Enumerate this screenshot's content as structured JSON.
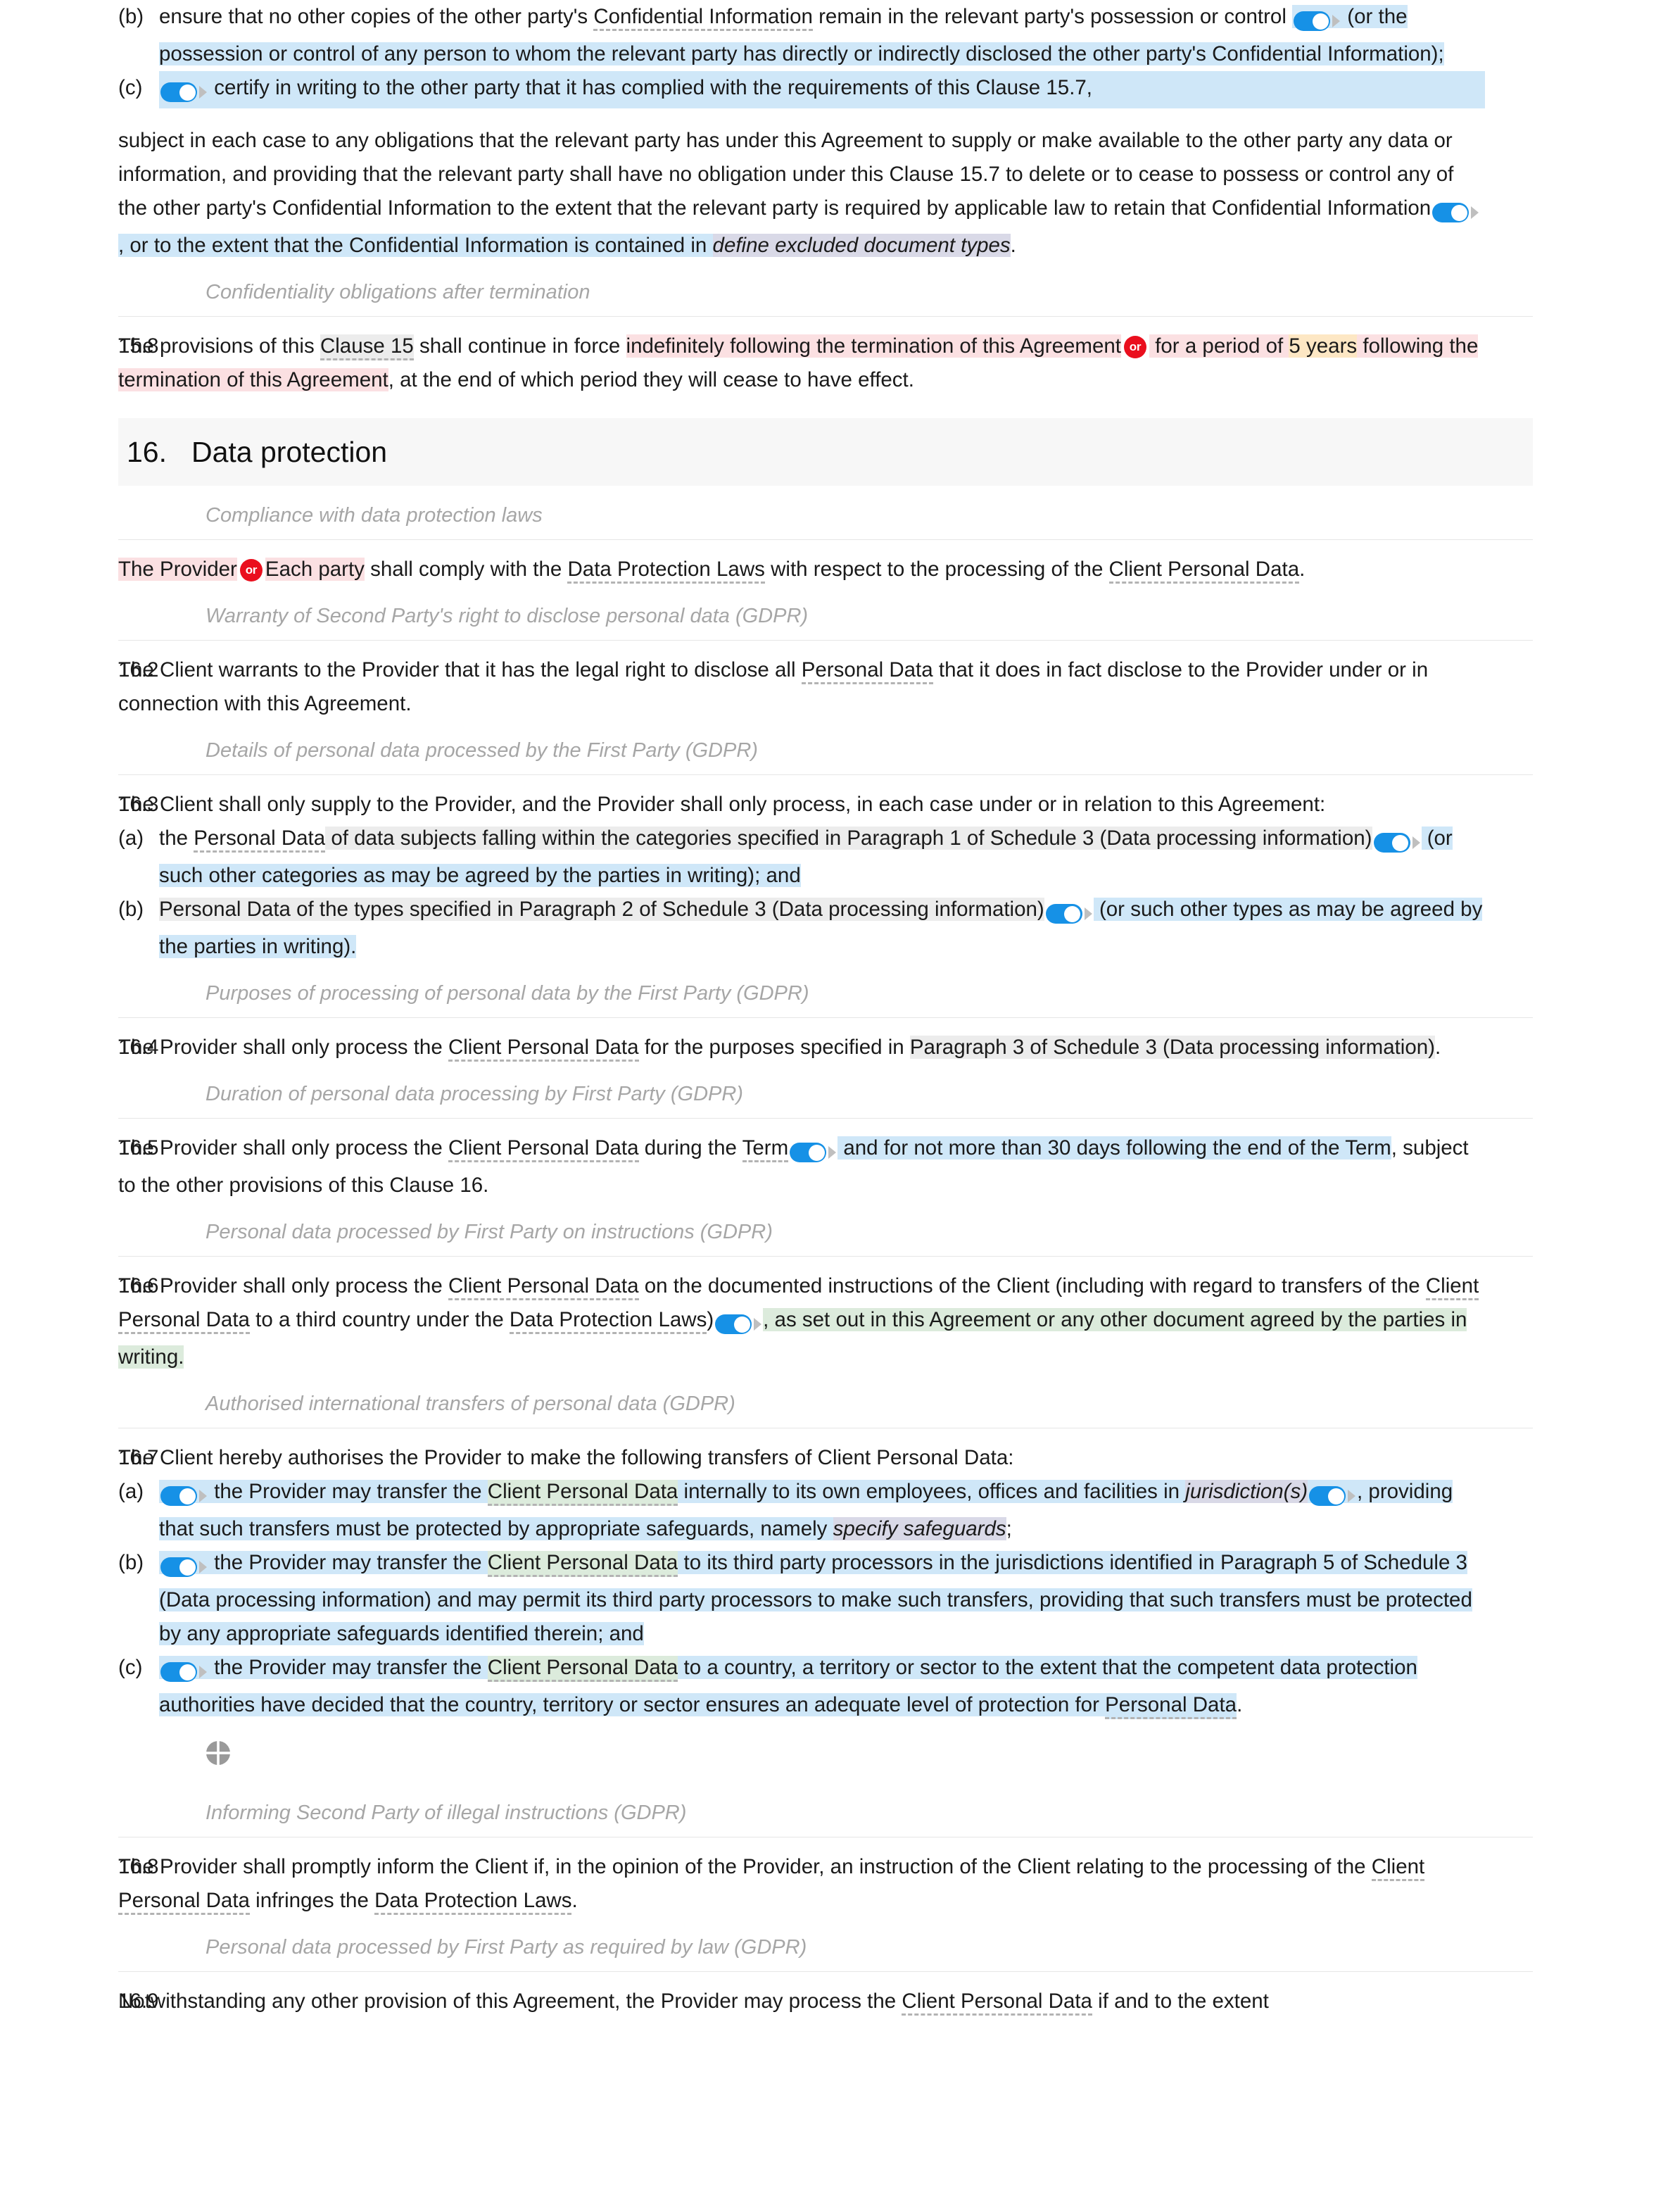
{
  "document": {
    "type": "legal-contract",
    "visible_sections": [
      "15 (continued)",
      "16. Data protection"
    ]
  },
  "colors": {
    "toggle_blue": "#1691e6",
    "or_badge_red": "#ea0f1e",
    "highlight_blue": "#cfe7f8",
    "highlight_green": "#dcebdc",
    "highlight_pink": "#fbe0e2",
    "highlight_orange": "#fde7c4",
    "highlight_grey": "#ececec",
    "highlight_lavender": "#d9d9e7",
    "subheading_grey": "#a6a6a6",
    "section_band": "#f7f7f7"
  },
  "icons": {
    "toggle": "toggle-switch-on-icon",
    "or_badge": "or-alternative-badge",
    "quadrant": "crosshair-quadrant-icon"
  },
  "clause_15_7": {
    "item_b_marker": "(b)",
    "item_b_text_1": "ensure that no other copies of the other party's ",
    "item_b_defined_1": "Confidential Information",
    "item_b_text_2": " remain in the relevant party's possession or control ",
    "item_b_text_3": " (or the possession or control of any person to whom the relevant party has directly or indirectly disclosed the other party's Confidential Information);",
    "item_c_marker": "(c)",
    "item_c_text": " certify in writing to the other party that it has complied with the requirements of this Clause 15.7,",
    "tail_1": "subject in each case to any obligations that the relevant party has under this Agreement to supply or make available to the other party any data or information, and providing that the relevant party shall have no obligation under this Clause 15.7 to delete or to cease to possess or control any of the other party's Confidential Information to the extent that the relevant party is required by applicable law to retain that Confidential Information",
    "tail_2": ", or to the extent that the Confidential Information is contained in ",
    "tail_placeholder": "define excluded document types",
    "tail_3": "."
  },
  "subheading_confidentiality": "Confidentiality obligations after termination",
  "clause_15_8": {
    "number": "15.8",
    "t1": "The provisions of this ",
    "defined_1": "Clause 15",
    "t2": " shall continue in force ",
    "alt_a": "indefinitely following the termination of this Agreement",
    "or": "or",
    "alt_b_pre": " for a period of ",
    "alt_b_num": "5 years",
    "alt_b_post": " following the termination of this Agreement",
    "t3": ", at the end of which period they will cease to have effect."
  },
  "section_16": {
    "number": "16.",
    "title": "Data protection"
  },
  "subheadings": {
    "compliance": "Compliance with data protection laws",
    "warranty": "Warranty of Second Party's right to disclose personal data (GDPR)",
    "details": "Details of personal data processed by the First Party (GDPR)",
    "purposes": "Purposes of processing of personal data by the First Party (GDPR)",
    "duration": "Duration of personal data processing by First Party (GDPR)",
    "instructions": "Personal data processed by First Party on instructions (GDPR)",
    "transfers": "Authorised international transfers of personal data (GDPR)",
    "informing": "Informing Second Party of illegal instructions (GDPR)",
    "required_by_law": "Personal data processed by First Party as required by law (GDPR)"
  },
  "clause_16_1": {
    "number": "16.1",
    "alt_a": "The Provider",
    "or": "or",
    "alt_b": "Each party",
    "t1": " shall comply with the ",
    "defined_1": "Data Protection Laws",
    "t2": " with respect to the processing of the ",
    "defined_2": "Client Personal Data",
    "t3": "."
  },
  "clause_16_2": {
    "number": "16.2",
    "t1": "The Client warrants to the Provider that it has the legal right to disclose all ",
    "defined_1": "Personal Data",
    "t2": " that it does in fact disclose to the Provider under or in connection with this Agreement."
  },
  "clause_16_3": {
    "number": "16.3",
    "lead": "The Client shall only supply to the Provider, and the Provider shall only process, in each case under or in relation to this Agreement:",
    "a_marker": "(a)",
    "a_t1": "the ",
    "a_defined": "Personal Data",
    "a_t2": " of data subjects falling within the categories specified in Paragraph 1 of Schedule 3 (Data processing information)",
    "a_t3": " (or such other categories as may be agreed by the parties in writing); and",
    "b_marker": "(b)",
    "b_t1": "Personal Data of the types specified in Paragraph 2 of Schedule 3 (Data processing information)",
    "b_t2": " (or such other types as may be agreed by the parties in writing)."
  },
  "clause_16_4": {
    "number": "16.4",
    "t1": "The Provider shall only process the ",
    "defined_1": "Client Personal Data",
    "t2": " for the purposes specified in ",
    "hl": "Paragraph 3 of Schedule 3 (Data processing information)",
    "t3": "."
  },
  "clause_16_5": {
    "number": "16.5",
    "t1": "The Provider shall only process the ",
    "defined_1": "Client Personal Data",
    "t2": " during the ",
    "defined_2": "Term",
    "t3": " and for not more than 30 days following the end of the Term",
    "t4": ", subject to the other provisions of this Clause 16."
  },
  "clause_16_6": {
    "number": "16.6",
    "t1": "The Provider shall only process the ",
    "defined_1": "Client Personal Data",
    "t2": " on the documented instructions of the Client (including with regard to transfers of the ",
    "defined_2": "Client Personal Data",
    "t3": " to a third country under the ",
    "defined_3": "Data Protection Laws",
    "t4": ")",
    "t5": ", as set out in this Agreement or any other document agreed by the parties in writing."
  },
  "clause_16_7": {
    "number": "16.7",
    "lead": "The Client hereby authorises the Provider to make the following transfers of Client Personal Data:",
    "a_marker": "(a)",
    "a_t1": " the Provider may transfer the ",
    "a_defined": "Client Personal Data",
    "a_t2": " internally to its own employees, offices and facilities in ",
    "a_placeholder": "jurisdiction(s)",
    "a_t3": ", providing that such transfers must be protected by appropriate safeguards, namely ",
    "a_placeholder2": "specify safeguards",
    "a_t4": ";",
    "b_marker": "(b)",
    "b_t1": " the Provider may transfer the ",
    "b_defined": "Client Personal Data",
    "b_t2": " to its third party processors in the jurisdictions identified in Paragraph 5 of Schedule 3 (Data processing information) and may permit its third party processors to make such transfers, providing that such transfers must be protected by any appropriate safeguards identified therein; and",
    "c_marker": "(c)",
    "c_t1": " the Provider may transfer the ",
    "c_defined": "Client Personal Data",
    "c_t2": " to a country, a territory or sector to the extent that the competent data protection authorities have decided that the country, territory or sector ensures an adequate level of protection for ",
    "c_defined2": "Personal Data",
    "c_t3": "."
  },
  "clause_16_8": {
    "number": "16.8",
    "t1": "The Provider shall promptly inform the Client if, in the opinion of the Provider, an instruction of the Client relating to the processing of the ",
    "defined_1": "Client Personal Data",
    "t2": " infringes the ",
    "defined_2": "Data Protection Laws",
    "t3": "."
  },
  "clause_16_9": {
    "number": "16.9",
    "t1": "Notwithstanding any other provision of this Agreement, the Provider may process the ",
    "defined_1": "Client Personal Data",
    "t2": " if and to the extent"
  }
}
